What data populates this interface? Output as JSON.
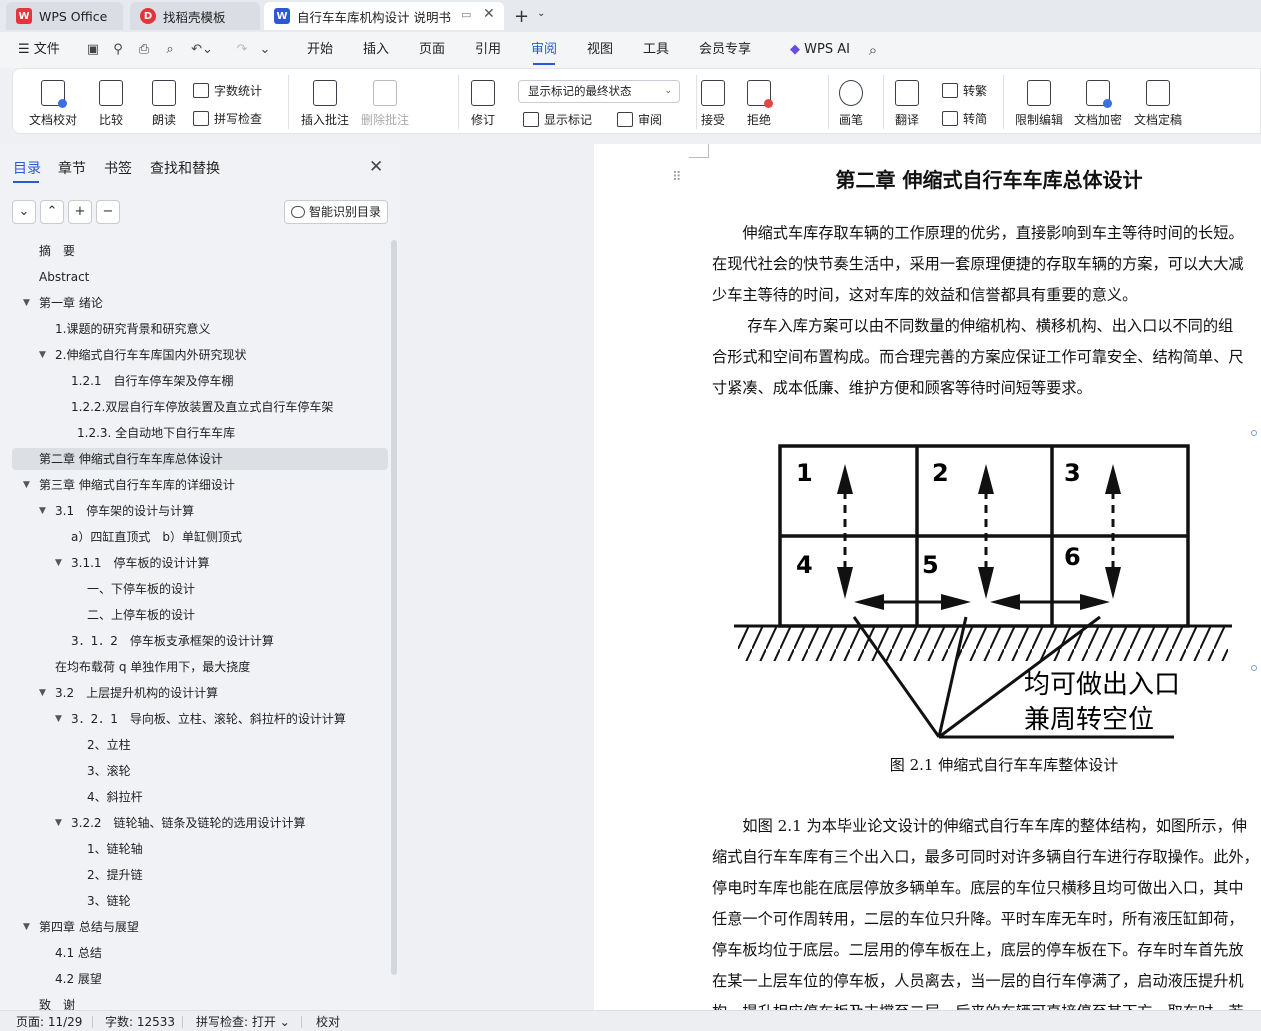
{
  "titlebar": {
    "tabs": [
      {
        "label": "WPS Office",
        "icon": "wps-logo-icon"
      },
      {
        "label": "找稻壳模板",
        "icon": "docer-icon"
      },
      {
        "label": "自行车车库机构设计 说明书（",
        "icon": "word-doc-icon"
      }
    ],
    "colors": {
      "wps_red": "#e8323c",
      "doc_blue": "#2b58d6"
    }
  },
  "menubar": {
    "file_label": "文件",
    "items": [
      "开始",
      "插入",
      "页面",
      "引用",
      "审阅",
      "视图",
      "工具",
      "会员专享"
    ],
    "selected": "审阅",
    "ai_label": "WPS AI"
  },
  "ribbon": {
    "doc_proofread": "文档校对",
    "compare": "比较",
    "read_aloud": "朗读",
    "word_count": "字数统计",
    "spell_check": "拼写检查",
    "insert_comment": "插入批注",
    "delete_comment": "删除批注",
    "track_changes": "修订",
    "markup_state": "显示标记的最终状态",
    "show_markup": "显示标记",
    "review": "审阅",
    "accept": "接受",
    "reject": "拒绝",
    "pen": "画笔",
    "translate": "翻译",
    "to_traditional": "转繁",
    "to_simplified": "转简",
    "restrict_edit": "限制编辑",
    "encrypt": "文档加密",
    "finalize": "文档定稿"
  },
  "nav": {
    "tabs": [
      "目录",
      "章节",
      "书签",
      "查找和替换"
    ],
    "smart_toc": "智能识别目录",
    "toc": [
      {
        "label": "摘　要",
        "level": 0,
        "arrow": ""
      },
      {
        "label": "Abstract",
        "level": 0,
        "arrow": ""
      },
      {
        "label": "第一章  绪论",
        "level": 0,
        "arrow": "▼"
      },
      {
        "label": "1.课题的研究背景和研究意义",
        "level": 1,
        "arrow": ""
      },
      {
        "label": "2.伸缩式自行车车库国内外研究现状",
        "level": 1,
        "arrow": "▼"
      },
      {
        "label": "1.2.1　自行车停车架及停车棚",
        "level": 2,
        "arrow": ""
      },
      {
        "label": "1.2.2.双层自行车停放装置及直立式自行车停车架",
        "level": 2,
        "arrow": ""
      },
      {
        "label": "1.2.3.  全自动地下自行车车库",
        "level": 2.4,
        "arrow": ""
      },
      {
        "label": "第二章  伸缩式自行车车库总体设计",
        "level": 0,
        "arrow": "",
        "selected": true
      },
      {
        "label": "第三章  伸缩式自行车车库的详细设计",
        "level": 0,
        "arrow": "▼"
      },
      {
        "label": "3.1　停车架的设计与计算",
        "level": 1,
        "arrow": "▼"
      },
      {
        "label": "a）四缸直顶式　b）单缸侧顶式",
        "level": 2,
        "arrow": ""
      },
      {
        "label": "3.1.1　停车板的设计计算",
        "level": 2,
        "arrow": "▼"
      },
      {
        "label": "一、下停车板的设计",
        "level": 3,
        "arrow": ""
      },
      {
        "label": "二、上停车板的设计",
        "level": 3,
        "arrow": ""
      },
      {
        "label": "3．1．2　停车板支承框架的设计计算",
        "level": 2,
        "arrow": ""
      },
      {
        "label": "在均布载荷 q 单独作用下，最大挠度",
        "level": 1,
        "arrow": ""
      },
      {
        "label": "3.2　上层提升机构的设计计算",
        "level": 1,
        "arrow": "▼"
      },
      {
        "label": "3．2．1　导向板、立柱、滚轮、斜拉杆的设计计算",
        "level": 2,
        "arrow": "▼"
      },
      {
        "label": "2、立柱",
        "level": 3,
        "arrow": ""
      },
      {
        "label": "3、滚轮",
        "level": 3,
        "arrow": ""
      },
      {
        "label": "4、斜拉杆",
        "level": 3,
        "arrow": ""
      },
      {
        "label": "3.2.2　链轮轴、链条及链轮的选用设计计算",
        "level": 2,
        "arrow": "▼"
      },
      {
        "label": "1、链轮轴",
        "level": 3,
        "arrow": ""
      },
      {
        "label": "2、提升链",
        "level": 3,
        "arrow": ""
      },
      {
        "label": "3、链轮",
        "level": 3,
        "arrow": ""
      },
      {
        "label": "第四章  总结与展望",
        "level": 0,
        "arrow": "▼"
      },
      {
        "label": "4.1  总结",
        "level": 1,
        "arrow": ""
      },
      {
        "label": "4.2  展望",
        "level": 1,
        "arrow": ""
      },
      {
        "label": "致　谢",
        "level": 0,
        "arrow": ""
      }
    ]
  },
  "document": {
    "chapter_title": "第二章  伸缩式自行车车库总体设计",
    "para1": [
      "　　伸缩式车库存取车辆的工作原理的优劣，直接影响到车主等待时间的长短。",
      "在现代社会的快节奏生活中，采用一套原理便捷的存取车辆的方案，可以大大减",
      "少车主等待的时间，这对车库的效益和信誉都具有重要的意义。"
    ],
    "para2": [
      "　　 存车入库方案可以由不同数量的伸缩机构、横移机构、出入口以不同的组",
      "合形式和空间布置构成。而合理完善的方案应保证工作可靠安全、结构简单、尺",
      "寸紧凑、成本低廉、维护方便和顾客等待时间短等要求。"
    ],
    "figure": {
      "cells": [
        "1",
        "2",
        "3",
        "4",
        "5",
        "6"
      ],
      "annotation_line1": "均可做出入口",
      "annotation_line2": "兼周转空位",
      "caption": "图 2.1 伸缩式自行车车库整体设计"
    },
    "para3": [
      "　　如图 2.1 为本毕业论文设计的伸缩式自行车车库的整体结构，如图所示，伸",
      "缩式自行车车库有三个出入口，最多可同时对许多辆自行车进行存取操作。此外，",
      "停电时车库也能在底层停放多辆单车。底层的车位只横移且均可做出入口，其中",
      "任意一个可作周转用，二层的车位只升降。平时车库无车时，所有液压缸卸荷，",
      "停车板均位于底层。二层用的停车板在上，底层的停车板在下。存车时车首先放",
      "在某一上层车位的停车板，人员离去，当一层的自行车停满了，启动液压提升机",
      "构，提升相应停车板及支撑至二层，后来的车辆可直接停至其下方。取车时，若"
    ]
  },
  "status": {
    "page": "页面: 11/29",
    "words": "字数: 12533",
    "spell": "拼写检查: 打开",
    "proof": "校对"
  }
}
